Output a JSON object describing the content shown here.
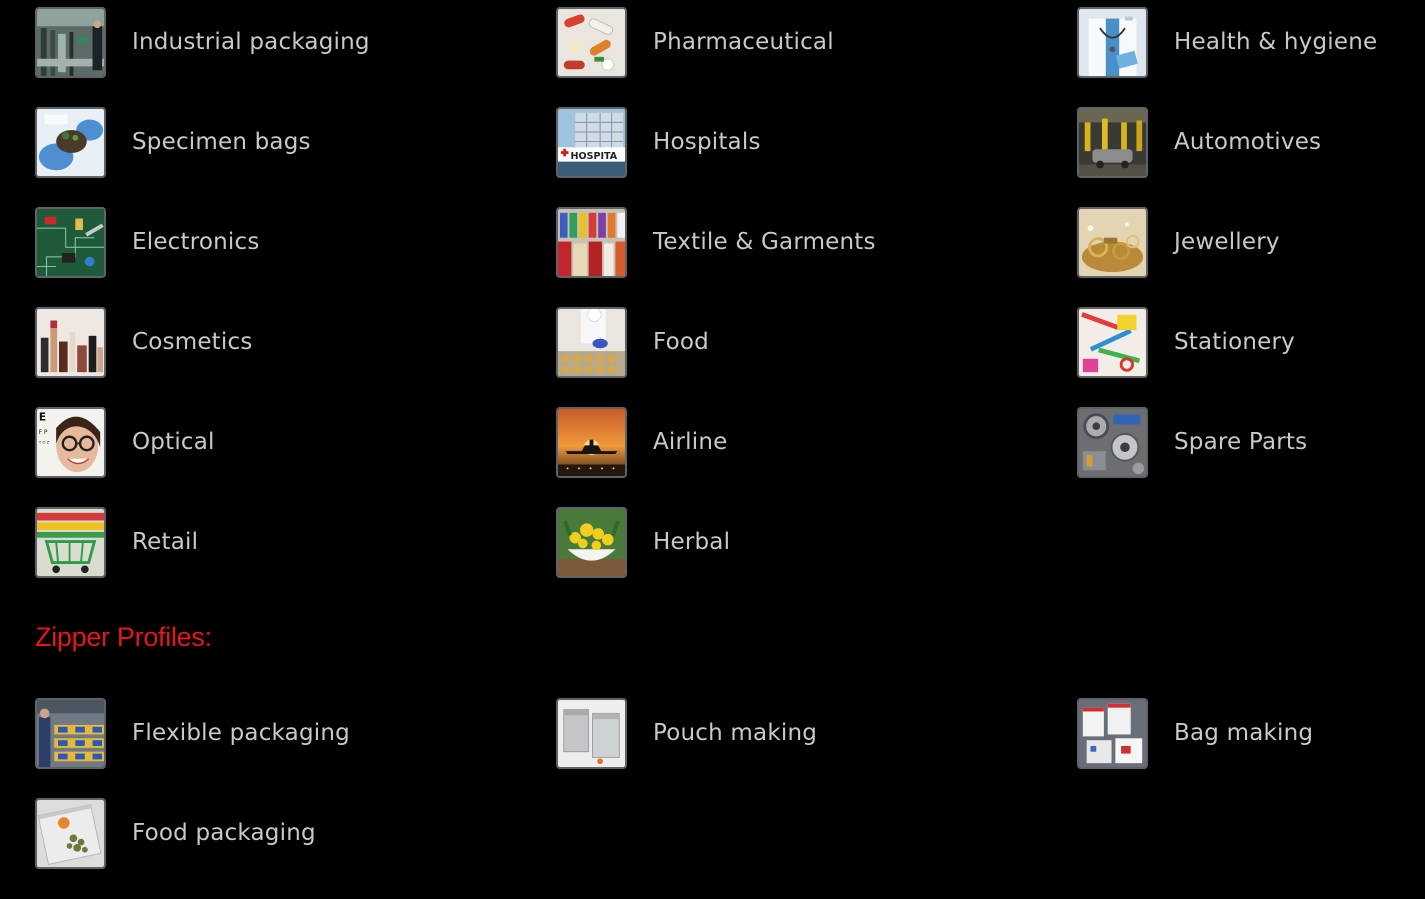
{
  "industries": [
    {
      "label": "Industrial packaging",
      "icon": "factory-line-image-icon"
    },
    {
      "label": "Pharmaceutical",
      "icon": "pills-image-icon"
    },
    {
      "label": "Health & hygiene",
      "icon": "doctor-image-icon"
    },
    {
      "label": "Specimen bags",
      "icon": "specimen-image-icon"
    },
    {
      "label": "Hospitals",
      "icon": "hospital-building-image-icon"
    },
    {
      "label": "Automotives",
      "icon": "car-assembly-image-icon"
    },
    {
      "label": "Electronics",
      "icon": "circuit-board-image-icon"
    },
    {
      "label": "Textile & Garments",
      "icon": "thread-spools-image-icon"
    },
    {
      "label": "Jewellery",
      "icon": "jewellery-image-icon"
    },
    {
      "label": "Cosmetics",
      "icon": "cosmetics-image-icon"
    },
    {
      "label": "Food",
      "icon": "food-trays-image-icon"
    },
    {
      "label": "Stationery",
      "icon": "stationery-image-icon"
    },
    {
      "label": "Optical",
      "icon": "glasses-woman-image-icon"
    },
    {
      "label": "Airline",
      "icon": "airplane-sunset-image-icon"
    },
    {
      "label": "Spare Parts",
      "icon": "spare-parts-image-icon"
    },
    {
      "label": "Retail",
      "icon": "shopping-cart-image-icon"
    },
    {
      "label": "Herbal",
      "icon": "herbal-flowers-image-icon"
    }
  ],
  "zipper_section": {
    "title": "Zipper Profiles:",
    "items": [
      {
        "label": "Flexible packaging",
        "icon": "film-rolls-image-icon"
      },
      {
        "label": "Pouch making",
        "icon": "foil-pouch-image-icon"
      },
      {
        "label": "Bag making",
        "icon": "zip-bags-image-icon"
      },
      {
        "label": "Food packaging",
        "icon": "food-zip-bag-image-icon"
      }
    ]
  },
  "colors": {
    "background": "#000000",
    "label_text": "#c9c9c9",
    "heading": "#e4171f",
    "thumb_border": "#5f6266"
  }
}
